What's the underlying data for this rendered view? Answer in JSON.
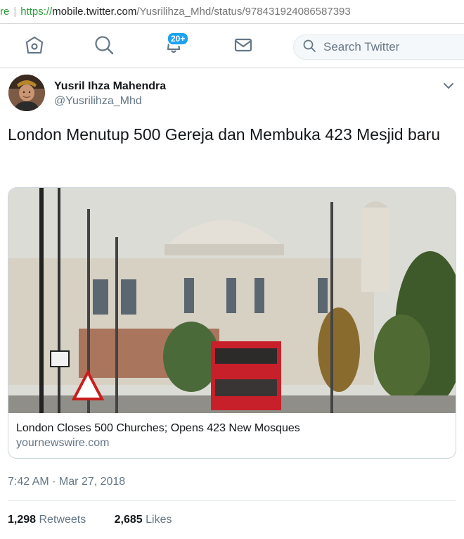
{
  "browser": {
    "secure_fragment": "re",
    "url_scheme": "https://",
    "url_host": "mobile.twitter.com",
    "url_path": "/Yusrilihza_Mhd/status/978431924086587393"
  },
  "nav": {
    "icons": [
      "home-icon",
      "search-icon",
      "notifications-icon",
      "messages-icon"
    ],
    "notification_badge": "20+",
    "search_placeholder": "Search Twitter"
  },
  "tweet": {
    "author_name": "Yusril Ihza Mahendra",
    "author_handle": "@Yusrilihza_Mhd",
    "text": "London Menutup 500 Gereja dan Membuka 423 Mesjid baru",
    "card": {
      "title": "London Closes 500 Churches; Opens 423 New Mosques",
      "domain": "yournewswire.com"
    },
    "timestamp": "7:42 AM · Mar 27, 2018",
    "retweets_count": "1,298",
    "retweets_label": "Retweets",
    "likes_count": "2,685",
    "likes_label": "Likes"
  },
  "colors": {
    "accent": "#1da1f2",
    "secondary_text": "#657786",
    "secure_green": "#2e9b3b"
  }
}
